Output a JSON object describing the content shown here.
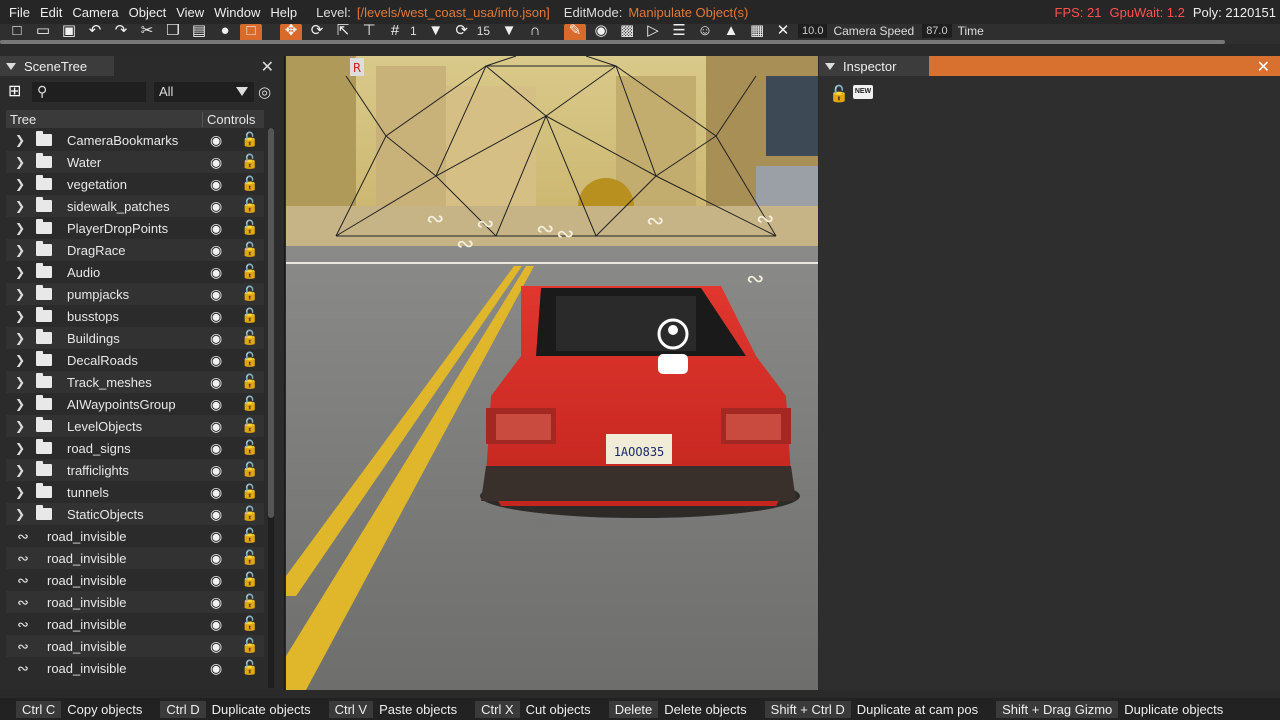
{
  "menubar": {
    "menus": [
      "File",
      "Edit",
      "Camera",
      "Object",
      "View",
      "Window",
      "Help"
    ],
    "level_label": "Level:",
    "level_path": "[/levels/west_coast_usa/info.json]",
    "editmode_label": "EditMode:",
    "editmode_value": "Manipulate Object(s)",
    "fps": "FPS: 21",
    "gpuwait": "GpuWait: 1.2",
    "poly": "Poly: 2120151"
  },
  "toolbar": {
    "step_value": "1",
    "rot_value": "15",
    "speed_field": "10.0",
    "camera_speed_label": "Camera Speed",
    "camera_speed_value": "87.0",
    "time_label": "Time"
  },
  "scenetree": {
    "title": "SceneTree",
    "search_placeholder": "",
    "filter_value": "All",
    "col_tree": "Tree",
    "col_controls": "Controls",
    "folders": [
      "CameraBookmarks",
      "Water",
      "vegetation",
      "sidewalk_patches",
      "PlayerDropPoints",
      "DragRace",
      "Audio",
      "pumpjacks",
      "busstops",
      "Buildings",
      "DecalRoads",
      "Track_meshes",
      "AIWaypointsGroup",
      "LevelObjects",
      "road_signs",
      "trafficlights",
      "tunnels",
      "StaticObjects"
    ],
    "objects": [
      "road_invisible",
      "road_invisible",
      "road_invisible",
      "road_invisible",
      "road_invisible",
      "road_invisible",
      "road_invisible"
    ]
  },
  "viewport": {
    "plate": "1AOO835"
  },
  "inspector": {
    "title": "Inspector",
    "new_badge": "NEW"
  },
  "statusbar": [
    {
      "key": "Ctrl C",
      "action": "Copy objects"
    },
    {
      "key": "Ctrl D",
      "action": "Duplicate objects"
    },
    {
      "key": "Ctrl V",
      "action": "Paste objects"
    },
    {
      "key": "Ctrl X",
      "action": "Cut objects"
    },
    {
      "key": "Delete",
      "action": "Delete objects"
    },
    {
      "key": "Shift + Ctrl D",
      "action": "Duplicate at cam pos"
    },
    {
      "key": "Shift + Drag Gizmo",
      "action": "Duplicate objects"
    }
  ]
}
